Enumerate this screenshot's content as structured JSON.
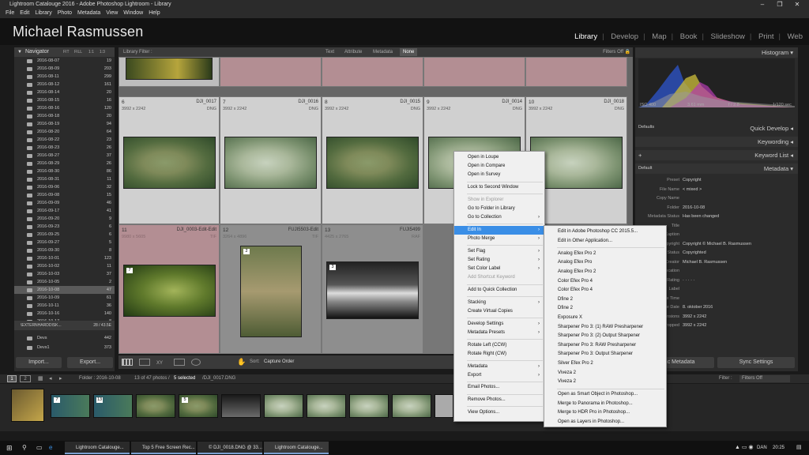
{
  "window": {
    "title": "Lightroom Catalouge 2016 - Adobe Photoshop Lightroom - Library"
  },
  "menubar": [
    "File",
    "Edit",
    "Library",
    "Photo",
    "Metadata",
    "View",
    "Window",
    "Help"
  ],
  "identity": {
    "name": "Michael Rasmussen"
  },
  "modules": [
    "Library",
    "Develop",
    "Map",
    "Book",
    "Slideshow",
    "Print",
    "Web"
  ],
  "left": {
    "navigator": "Navigator",
    "nav_zoom": [
      "FIT",
      "FILL",
      "1:1",
      "1:3"
    ],
    "folders": [
      {
        "label": "2016-08-07",
        "count": "19"
      },
      {
        "label": "2016-08-09",
        "count": "203"
      },
      {
        "label": "2016-08-11",
        "count": "299"
      },
      {
        "label": "2016-08-12",
        "count": "161"
      },
      {
        "label": "2016-08-14",
        "count": "20"
      },
      {
        "label": "2016-08-15",
        "count": "16"
      },
      {
        "label": "2016-08-16",
        "count": "120"
      },
      {
        "label": "2016-08-18",
        "count": "20"
      },
      {
        "label": "2016-08-19",
        "count": "94"
      },
      {
        "label": "2016-08-20",
        "count": "64"
      },
      {
        "label": "2016-08-22",
        "count": "23"
      },
      {
        "label": "2016-08-23",
        "count": "26"
      },
      {
        "label": "2016-08-27",
        "count": "37"
      },
      {
        "label": "2016-08-29",
        "count": "26"
      },
      {
        "label": "2016-08-30",
        "count": "86"
      },
      {
        "label": "2016-08-31",
        "count": "11"
      },
      {
        "label": "2016-09-06",
        "count": "32"
      },
      {
        "label": "2016-09-08",
        "count": "15"
      },
      {
        "label": "2016-09-09",
        "count": "46"
      },
      {
        "label": "2016-09-17",
        "count": "41"
      },
      {
        "label": "2016-09-20",
        "count": "9"
      },
      {
        "label": "2016-09-23",
        "count": "6"
      },
      {
        "label": "2016-09-25",
        "count": "6"
      },
      {
        "label": "2016-09-27",
        "count": "5"
      },
      {
        "label": "2016-09-30",
        "count": "8"
      },
      {
        "label": "2016-10-01",
        "count": "123"
      },
      {
        "label": "2016-10-02",
        "count": "11"
      },
      {
        "label": "2016-10-03",
        "count": "37"
      },
      {
        "label": "2016-10-05",
        "count": "2"
      },
      {
        "label": "2016-10-08",
        "count": "47"
      },
      {
        "label": "2016-10-09",
        "count": "61"
      },
      {
        "label": "2016-10-11",
        "count": "36"
      },
      {
        "label": "2016-10-16",
        "count": "140"
      },
      {
        "label": "2016-10-17",
        "count": "8"
      }
    ],
    "selected_folder": "2016-10-08",
    "drive": {
      "label": "\\EXTERNHARDDISK...",
      "count": "28 / 43.5E"
    },
    "drive_folders": [
      {
        "label": "Devs",
        "count": "442"
      },
      {
        "label": "Devs1",
        "count": "373"
      }
    ],
    "import_label": "Import...",
    "export_label": "Export..."
  },
  "library_filter": {
    "label": "Library Filter :",
    "tabs": [
      "Text",
      "Attribute",
      "Metadata",
      "None"
    ],
    "status": "Filters Off"
  },
  "grid": {
    "cells_row2": [
      {
        "num": "6",
        "file": "DJI_0017",
        "dims": "3992 x 2242",
        "ext": "DNG"
      },
      {
        "num": "7",
        "file": "DJI_0016",
        "dims": "3992 x 2242",
        "ext": "DNG"
      },
      {
        "num": "8",
        "file": "DJI_0015",
        "dims": "3992 x 2242",
        "ext": "DNG"
      },
      {
        "num": "9",
        "file": "DJI_0014",
        "dims": "3992 x 2242",
        "ext": "DNG"
      },
      {
        "num": "10",
        "file": "DJI_0018",
        "dims": "3992 x 2242",
        "ext": "DNG"
      }
    ],
    "cells_row3": [
      {
        "num": "11",
        "file": "DJI_0003-Edit-Edit",
        "dims": "9980 x 5605",
        "ext": "TIF"
      },
      {
        "num": "12",
        "file": "FUJI5503-Edit",
        "dims": "3264 x 4896",
        "ext": "TIF"
      },
      {
        "num": "13",
        "file": "FUJI5499",
        "dims": "4425 x 2765",
        "ext": "RAF"
      }
    ],
    "stacks": [
      "7",
      "2",
      "3"
    ]
  },
  "toolbar": {
    "sort_label": "Sort:",
    "sort_value": "Capture Order"
  },
  "right": {
    "histogram": "Histogram",
    "hist_info": [
      "ISO 400",
      "3.61 mm",
      "f / 2.8",
      "1/120 sec"
    ],
    "quick_develop": "Quick Develop",
    "qd_preset": "Defaults",
    "keywording": "Keywording",
    "keyword_list": "Keyword List",
    "metadata": "Metadata",
    "md_preset": "Default",
    "rows": [
      {
        "k": "Preset",
        "v": "Copyright"
      },
      {
        "k": "File Name",
        "v": "< mixed >"
      },
      {
        "k": "Copy Name",
        "v": ""
      },
      {
        "k": "Folder",
        "v": "2016-10-08"
      },
      {
        "k": "Metadata Status",
        "v": "Has been changed"
      },
      {
        "k": "Title",
        "v": ""
      },
      {
        "k": "Caption",
        "v": ""
      },
      {
        "k": "Copyright",
        "v": "Copyright © Michael B. Rasmussen"
      },
      {
        "k": "Copyright Status",
        "v": "Copyrighted"
      },
      {
        "k": "Creator",
        "v": "Michael B. Rasmussen"
      },
      {
        "k": "Location",
        "v": ""
      },
      {
        "k": "Rating",
        "v": "· · · · ·"
      },
      {
        "k": "Label",
        "v": ""
      },
      {
        "k": "Capture Time",
        "v": ""
      },
      {
        "k": "Capture Date",
        "v": "8. oktober 2016"
      },
      {
        "k": "Dimensions",
        "v": "3992 x 2242"
      },
      {
        "k": "Cropped",
        "v": "3992 x 2242"
      }
    ],
    "sync_metadata": "Sync Metadata",
    "sync_settings": "Sync Settings"
  },
  "filmstrip": {
    "pages": [
      "1",
      "2"
    ],
    "path": "Folder : 2016-10-08",
    "count": "13 of 47 photos /",
    "selected": "5 selected",
    "file": "/DJI_0017.DNG",
    "filter_label": "Filter :",
    "filter_value": "Filters Off",
    "stack_nums": [
      "7",
      "13",
      "5"
    ]
  },
  "context_menu": {
    "items": [
      {
        "label": "Open in Loupe"
      },
      {
        "label": "Open in Compare"
      },
      {
        "label": "Open in Survey"
      },
      {
        "sep": true
      },
      {
        "label": "Lock to Second Window"
      },
      {
        "sep": true
      },
      {
        "label": "Show in Explorer",
        "disabled": true
      },
      {
        "label": "Go to Folder in Library"
      },
      {
        "label": "Go to Collection",
        "arrow": true
      },
      {
        "sep": true
      },
      {
        "label": "Edit In",
        "arrow": true,
        "highlight": true
      },
      {
        "label": "Photo Merge",
        "arrow": true
      },
      {
        "sep": true
      },
      {
        "label": "Set Flag",
        "arrow": true
      },
      {
        "label": "Set Rating",
        "arrow": true
      },
      {
        "label": "Set Color Label",
        "arrow": true
      },
      {
        "label": "Add Shortcut Keyword",
        "disabled": true
      },
      {
        "sep": true
      },
      {
        "label": "Add to Quick Collection"
      },
      {
        "sep": true
      },
      {
        "label": "Stacking",
        "arrow": true
      },
      {
        "label": "Create Virtual Copies"
      },
      {
        "sep": true
      },
      {
        "label": "Develop Settings",
        "arrow": true
      },
      {
        "label": "Metadata Presets",
        "arrow": true
      },
      {
        "sep": true
      },
      {
        "label": "Rotate Left (CCW)"
      },
      {
        "label": "Rotate Right (CW)"
      },
      {
        "sep": true
      },
      {
        "label": "Metadata",
        "arrow": true
      },
      {
        "label": "Export",
        "arrow": true
      },
      {
        "sep": true
      },
      {
        "label": "Email Photos..."
      },
      {
        "sep": true
      },
      {
        "label": "Remove Photos..."
      },
      {
        "sep": true
      },
      {
        "label": "View Options..."
      }
    ]
  },
  "submenu": {
    "items": [
      {
        "label": "Edit in Adobe Photoshop CC 2015.5..."
      },
      {
        "label": "Edit in Other Application..."
      },
      {
        "sep": true
      },
      {
        "label": "Analog Efex Pro 2"
      },
      {
        "label": "Analog Efex Pro"
      },
      {
        "label": "Analog Efex Pro 2"
      },
      {
        "label": "Color Efex Pro 4"
      },
      {
        "label": "Color Efex Pro 4"
      },
      {
        "label": "Dfine 2"
      },
      {
        "label": "Dfine 2"
      },
      {
        "label": "Exposure X"
      },
      {
        "label": "Sharpener Pro 3: (1) RAW Presharpener"
      },
      {
        "label": "Sharpener Pro 3: (2) Output Sharpener"
      },
      {
        "label": "Sharpener Pro 3: RAW Presharpener"
      },
      {
        "label": "Sharpener Pro 3: Output Sharpener"
      },
      {
        "label": "Silver Efex Pro 2"
      },
      {
        "label": "Viveza 2"
      },
      {
        "label": "Viveza 2"
      },
      {
        "sep": true
      },
      {
        "label": "Open as Smart Object in Photoshop..."
      },
      {
        "label": "Merge to Panorama in Photoshop..."
      },
      {
        "label": "Merge to HDR Pro in Photoshop..."
      },
      {
        "label": "Open as Layers in Photoshop..."
      }
    ]
  },
  "taskbar": {
    "buttons": [
      "Lightroom Catalouge...",
      "Top 5 Free Screen Rec...",
      "© DJI_0018.DNG @ 33...",
      "Lightroom Catalouge..."
    ],
    "lang": "DAN",
    "time": "20:25"
  }
}
